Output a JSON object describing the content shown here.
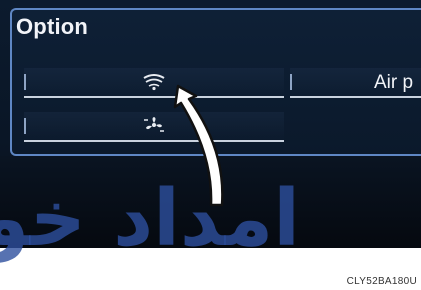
{
  "option_panel": {
    "title": "Option",
    "buttons": [
      {
        "icon": "windshield-defog-icon"
      },
      {
        "label": "Air p"
      },
      {
        "icon": "fan-air-icon"
      }
    ]
  },
  "watermark": "امداد خو",
  "figure_code": "CLY52BA180U",
  "colors": {
    "panel_border": "#5f87c4",
    "screen_bg": "#0c1b2e",
    "watermark": "#2d4f9e"
  }
}
